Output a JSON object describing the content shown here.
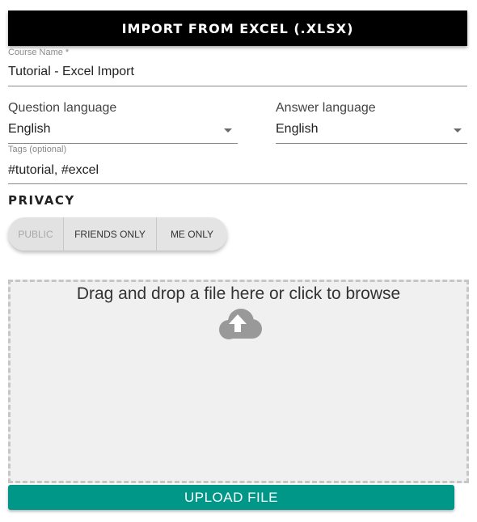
{
  "header": {
    "title": "IMPORT FROM EXCEL (.XLSX)"
  },
  "course_name": {
    "label": "Course Name *",
    "value": "Tutorial - Excel Import"
  },
  "question_language": {
    "label": "Question language",
    "value": "English"
  },
  "answer_language": {
    "label": "Answer language",
    "value": "English"
  },
  "tags": {
    "label": "Tags (optional)",
    "value": "#tutorial, #excel"
  },
  "privacy": {
    "heading": "PRIVACY",
    "options": [
      {
        "label": "PUBLIC",
        "state": "disabled"
      },
      {
        "label": "FRIENDS ONLY",
        "state": "enabled"
      },
      {
        "label": "ME ONLY",
        "state": "enabled"
      }
    ]
  },
  "dropzone": {
    "text": "Drag and drop a file here or click to browse",
    "icon": "cloud-upload-icon"
  },
  "upload_button": {
    "label": "UPLOAD FILE"
  },
  "colors": {
    "header_bg": "#000000",
    "button_bg": "#009688",
    "dropzone_bg": "#f0f0f0"
  }
}
